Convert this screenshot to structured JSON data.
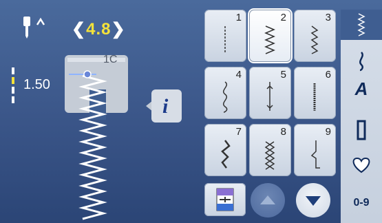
{
  "header": {
    "needle_position_icon": "needle-up-icon",
    "stitch_width_value": "4.8",
    "width_left_chevron": "❮",
    "width_right_chevron": "❯",
    "stitch_length_value": "1.50"
  },
  "presser_foot": {
    "label": "1C"
  },
  "info_button": {
    "label": "i"
  },
  "stitch_grid": [
    {
      "number": "1",
      "icon": "straight-stitch-icon",
      "selected": false
    },
    {
      "number": "2",
      "icon": "zigzag-stitch-icon",
      "selected": true
    },
    {
      "number": "3",
      "icon": "vari-overlock-icon",
      "selected": false
    },
    {
      "number": "4",
      "icon": "serpentine-stitch-icon",
      "selected": false
    },
    {
      "number": "5",
      "icon": "securing-program-icon",
      "selected": false
    },
    {
      "number": "6",
      "icon": "triple-straight-stitch-icon",
      "selected": false
    },
    {
      "number": "7",
      "icon": "triple-zigzag-icon",
      "selected": false
    },
    {
      "number": "8",
      "icon": "honeycomb-stitch-icon",
      "selected": false
    },
    {
      "number": "9",
      "icon": "blind-stitch-icon",
      "selected": false
    }
  ],
  "sidebar": {
    "items": [
      {
        "name": "practical-stitches",
        "icon": "decorative-stitch-icon"
      },
      {
        "name": "practical-stitches-active",
        "icon": "practical-stitch-icon"
      },
      {
        "name": "alphabets",
        "icon": "alphabet-icon",
        "label": "A"
      },
      {
        "name": "buttonholes",
        "icon": "buttonhole-icon"
      },
      {
        "name": "quilt-stitches",
        "icon": "heart-icon"
      },
      {
        "name": "numeric-input",
        "label": "0-9"
      }
    ]
  },
  "bottom": {
    "left_icon": "balance-icon",
    "scroll_up_icon": "triangle-up-icon",
    "scroll_down_icon": "triangle-down-icon"
  },
  "colors": {
    "accent_value": "#f4e23a",
    "background": "#3a5588",
    "button_light": "#e3e9f1",
    "icon_navy": "#0f2a5a"
  }
}
